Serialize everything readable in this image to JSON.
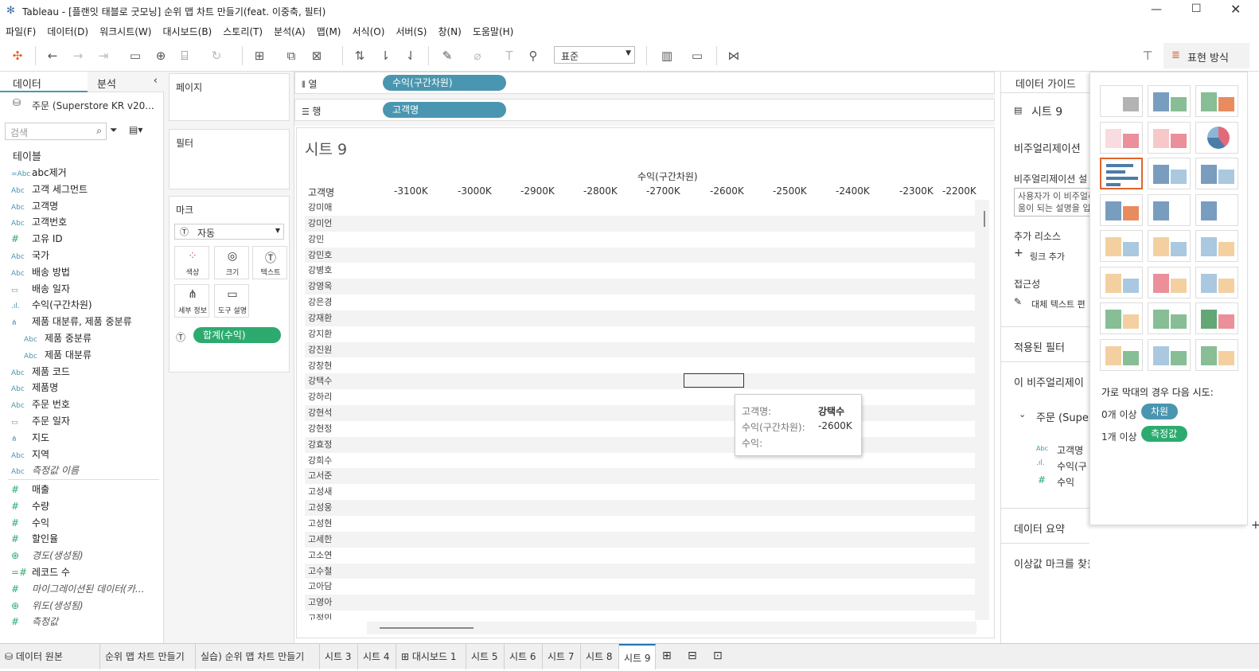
{
  "window": {
    "title": "Tableau - [플랜잇 태블로 굿모닝] 순위 맵 차트 만들기(feat. 이중축, 필터)"
  },
  "menu": [
    "파일(F)",
    "데이터(D)",
    "워크시트(W)",
    "대시보드(B)",
    "스토리(T)",
    "분석(A)",
    "맵(M)",
    "서식(O)",
    "서버(S)",
    "창(N)",
    "도움말(H)"
  ],
  "toolbar": {
    "fit_select": "표준",
    "showme_label": "표현 방식"
  },
  "left": {
    "tab_data": "데이터",
    "tab_analysis": "분석",
    "datasource": "주문 (Superstore KR v20...",
    "search_placeholder": "검색",
    "tables_label": "테이블",
    "fields": [
      {
        "icon": "=Abc",
        "name": "abc제거",
        "italic": false
      },
      {
        "icon": "Abc",
        "name": "고객 세그먼트",
        "italic": false
      },
      {
        "icon": "Abc",
        "name": "고객명",
        "italic": false
      },
      {
        "icon": "Abc",
        "name": "고객번호",
        "italic": false
      },
      {
        "icon": "#",
        "name": "고유 ID",
        "italic": false
      },
      {
        "icon": "Abc",
        "name": "국가",
        "italic": false
      },
      {
        "icon": "Abc",
        "name": "배송 방법",
        "italic": false
      },
      {
        "icon": "cal",
        "name": "배송 일자",
        "italic": false
      },
      {
        "icon": "bin",
        "name": "수익(구간차원)",
        "italic": false
      },
      {
        "icon": "hier",
        "name": "제품 대분류, 제품 중분류",
        "italic": false
      },
      {
        "icon": "Abc",
        "name": "제품 중분류",
        "italic": false,
        "indent": true
      },
      {
        "icon": "Abc",
        "name": "제품 대분류",
        "italic": false,
        "indent": true
      },
      {
        "icon": "Abc",
        "name": "제품 코드",
        "italic": false
      },
      {
        "icon": "Abc",
        "name": "제품명",
        "italic": false
      },
      {
        "icon": "Abc",
        "name": "주문 번호",
        "italic": false
      },
      {
        "icon": "cal",
        "name": "주문 일자",
        "italic": false
      },
      {
        "icon": "hier",
        "name": "지도",
        "italic": false
      },
      {
        "icon": "Abc",
        "name": "지역",
        "italic": false
      },
      {
        "icon": "Abc",
        "name": "측정값 이름",
        "italic": true
      }
    ],
    "measures": [
      {
        "icon": "#",
        "name": "매출",
        "italic": false
      },
      {
        "icon": "#",
        "name": "수량",
        "italic": false
      },
      {
        "icon": "#",
        "name": "수익",
        "italic": false
      },
      {
        "icon": "#",
        "name": "할인율",
        "italic": false
      },
      {
        "icon": "globe",
        "name": "경도(생성됨)",
        "italic": true
      },
      {
        "icon": "=#",
        "name": "레코드 수",
        "italic": false
      },
      {
        "icon": "#",
        "name": "마이그레이션된 데이터(카...",
        "italic": true
      },
      {
        "icon": "globe",
        "name": "위도(생성됨)",
        "italic": true
      },
      {
        "icon": "#",
        "name": "측정값",
        "italic": true
      }
    ]
  },
  "shelves": {
    "pages": "페이지",
    "filters": "필터",
    "marks": "마크",
    "mark_type": "자동",
    "mark_buttons": [
      "색상",
      "크기",
      "텍스트",
      "세부 정보",
      "도구 설명"
    ],
    "mark_pill": "합계(수익)",
    "columns_label": "열",
    "rows_label": "행",
    "columns_pill": "수익(구간차원)",
    "rows_pill": "고객명"
  },
  "view": {
    "sheet_title": "시트 9",
    "axis_title": "수익(구간차원)",
    "row_header": "고객명",
    "ticks": [
      "-3100K",
      "-3000K",
      "-2900K",
      "-2800K",
      "-2700K",
      "-2600K",
      "-2500K",
      "-2400K",
      "-2300K",
      "-2200K"
    ],
    "rows": [
      "강미애",
      "강미언",
      "강민",
      "강민호",
      "강병호",
      "강영옥",
      "강은경",
      "강재환",
      "강지환",
      "강진원",
      "강창현",
      "강택수",
      "강하리",
      "강현석",
      "강현정",
      "강효정",
      "강희수",
      "고서준",
      "고성새",
      "고성웅",
      "고성현",
      "고세한",
      "고소연",
      "고수철",
      "고아담",
      "고영아",
      "고정민"
    ],
    "tooltip": {
      "k1": "고객명:",
      "v1": "강택수",
      "k2": "수익(구간차원):",
      "v2": "-2600K",
      "k3": "수익:"
    }
  },
  "guide": {
    "tab": "데이터 가이드",
    "sheet": "시트 9",
    "viz_heading": "비주얼리제이션",
    "viz_desc_label": "비주얼리제이션 설",
    "viz_desc_placeholder": "사용자가 이 비주얼리제이션을 이해하는 데 도움이 되는 설명을 입력",
    "resources": "추가 리소스",
    "add_link": "링크 추가",
    "accessibility": "접근성",
    "alt_text": "대체 텍스트 편",
    "applied_filters": "적용된 필터",
    "this_viz": "이 비주얼리제이",
    "source": "주문 (Supe",
    "f1": "고객명",
    "f2": "수익(구",
    "f3": "수익",
    "summary": "데이터 요약",
    "outlier": "이상값 마크를 찾을 수 없음"
  },
  "showme": {
    "hint": "가로 막대의 경우 다음 시도:",
    "req1": "0개 이상",
    "pill1": "차원",
    "req2": "1개 이상",
    "pill2": "측정값"
  },
  "tabs": [
    "데이터 원본",
    "순위 맵 차트 만들기",
    "실습) 순위 맵 차트 만들기",
    "시트 3",
    "시트 4",
    "대시보드 1",
    "시트 5",
    "시트 6",
    "시트 7",
    "시트 8",
    "시트 9"
  ]
}
